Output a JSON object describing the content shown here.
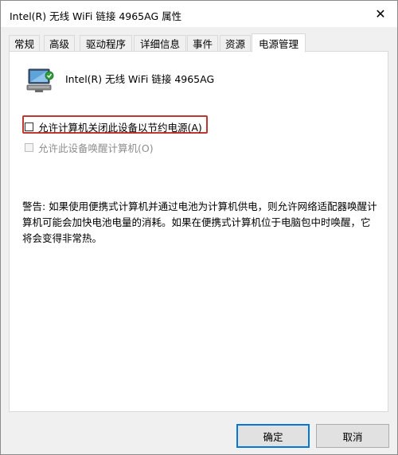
{
  "window": {
    "title": "Intel(R) 无线 WiFi 链接 4965AG 属性",
    "close_glyph": "✕"
  },
  "tabs": [
    {
      "label": "常规"
    },
    {
      "label": "高级"
    },
    {
      "label": "驱动程序"
    },
    {
      "label": "详细信息"
    },
    {
      "label": "事件"
    },
    {
      "label": "资源"
    },
    {
      "label": "电源管理",
      "active": true
    }
  ],
  "device": {
    "icon": "network-adapter-icon",
    "name": "Intel(R) 无线 WiFi 链接 4965AG"
  },
  "options": {
    "allow_power_off": {
      "label": "允许计算机关闭此设备以节约电源(A)",
      "checked": false
    },
    "allow_wake": {
      "label": "允许此设备唤醒计算机(O)",
      "checked": false,
      "disabled": true
    }
  },
  "warning_text": "警告: 如果使用便携式计算机并通过电池为计算机供电，则允许网络适配器唤醒计算机可能会加快电池电量的消耗。如果在便携式计算机位于电脑包中时唤醒，它将会变得非常热。",
  "buttons": {
    "ok": "确定",
    "cancel": "取消"
  },
  "colors": {
    "highlight": "#c0372f",
    "default_button_border": "#0078d7"
  }
}
